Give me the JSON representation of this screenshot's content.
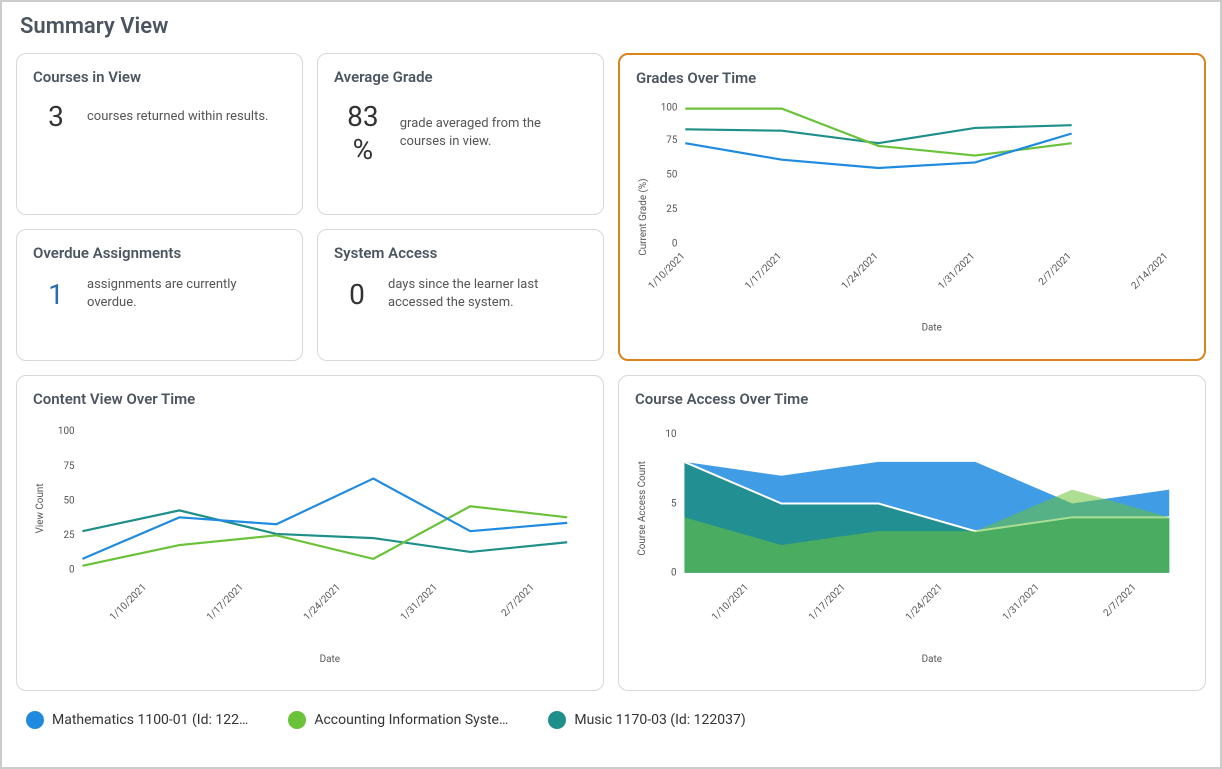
{
  "page": {
    "title": "Summary View"
  },
  "stats": {
    "courses": {
      "title": "Courses in View",
      "value": "3",
      "desc": "courses returned within results."
    },
    "avg_grade": {
      "title": "Average Grade",
      "value": "83 %",
      "desc": "grade averaged from the courses in view."
    },
    "overdue": {
      "title": "Overdue Assignments",
      "value": "1",
      "desc": "assignments are currently overdue."
    },
    "access": {
      "title": "System Access",
      "value": "0",
      "desc": "days since the learner last accessed the system."
    }
  },
  "charts": {
    "grades": {
      "title": "Grades Over Time",
      "ylabel": "Current Grade (%)",
      "xlabel": "Date"
    },
    "content": {
      "title": "Content View Over Time",
      "ylabel": "View Count",
      "xlabel": "Date"
    },
    "course_access": {
      "title": "Course Access Over Time",
      "ylabel": "Course Access Count",
      "xlabel": "Date"
    }
  },
  "legend": {
    "s1": "Mathematics 1100-01 (Id: 122…",
    "s2": "Accounting Information Syste…",
    "s3": "Music 1170-03 (Id: 122037)"
  },
  "chart_data": [
    {
      "type": "line",
      "title": "Grades Over Time",
      "xlabel": "Date",
      "ylabel": "Current Grade (%)",
      "ylim": [
        0,
        100
      ],
      "categories": [
        "1/10/2021",
        "1/17/2021",
        "1/24/2021",
        "1/31/2021",
        "2/7/2021",
        "2/14/2021"
      ],
      "series": [
        {
          "name": "Mathematics 1100-01",
          "values": [
            75,
            63,
            57,
            61,
            82,
            null
          ]
        },
        {
          "name": "Accounting Information Systems",
          "values": [
            100,
            100,
            73,
            66,
            75,
            null
          ]
        },
        {
          "name": "Music 1170-03",
          "values": [
            85,
            84,
            75,
            86,
            88,
            null
          ]
        }
      ]
    },
    {
      "type": "line",
      "title": "Content View Over Time",
      "xlabel": "Date",
      "ylabel": "View Count",
      "ylim": [
        0,
        100
      ],
      "categories": [
        "1/10/2021",
        "1/17/2021",
        "1/24/2021",
        "1/31/2021",
        "2/7/2021"
      ],
      "series": [
        {
          "name": "Mathematics 1100-01",
          "values": [
            10,
            40,
            35,
            68,
            30,
            36
          ]
        },
        {
          "name": "Accounting Information Systems",
          "values": [
            5,
            20,
            27,
            10,
            48,
            40
          ]
        },
        {
          "name": "Music 1170-03",
          "values": [
            30,
            45,
            28,
            25,
            15,
            22
          ]
        }
      ]
    },
    {
      "type": "area",
      "title": "Course Access Over Time",
      "xlabel": "Date",
      "ylabel": "Course Access Count",
      "ylim": [
        0,
        10
      ],
      "categories": [
        "1/10/2021",
        "1/17/2021",
        "1/24/2021",
        "1/31/2021",
        "2/7/2021"
      ],
      "series": [
        {
          "name": "Mathematics 1100-01",
          "values": [
            8,
            7,
            8,
            8,
            5,
            6
          ]
        },
        {
          "name": "Accounting Information Systems",
          "values": [
            4,
            2,
            3,
            3,
            6,
            4
          ]
        },
        {
          "name": "Music 1170-03",
          "values": [
            8,
            5,
            5,
            3,
            4,
            4
          ]
        }
      ]
    }
  ]
}
